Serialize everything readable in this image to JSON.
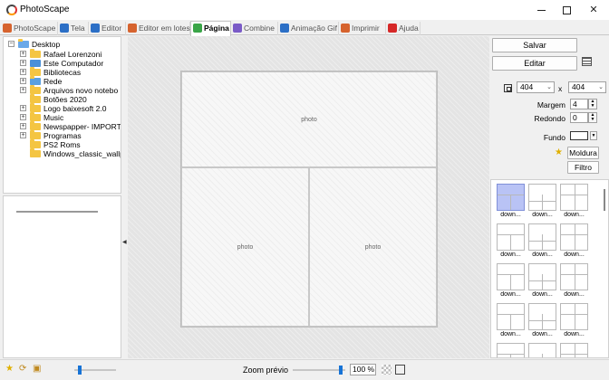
{
  "window": {
    "title": "PhotoScape",
    "min_glyph": "—",
    "close_glyph": "✕"
  },
  "tabs": [
    {
      "label": "PhotoScape",
      "icon": "photoscape-icon",
      "color": "#d6632e"
    },
    {
      "label": "Tela",
      "icon": "viewer-icon",
      "color": "#2c6fc6"
    },
    {
      "label": "Editor",
      "icon": "editor-icon",
      "color": "#2c6fc6"
    },
    {
      "label": "Editor em lotes",
      "icon": "batch-editor-icon",
      "color": "#d6632e"
    },
    {
      "label": "Página",
      "icon": "page-icon",
      "color": "#3aa548",
      "active": true
    },
    {
      "label": "Combine",
      "icon": "combine-icon",
      "color": "#7a5bc7"
    },
    {
      "label": "Animação Gif",
      "icon": "animated-gif-icon",
      "color": "#2c6fc6"
    },
    {
      "label": "Imprimir",
      "icon": "print-icon",
      "color": "#d6632e"
    },
    {
      "label": "Ajuda",
      "icon": "help-icon",
      "color": "#d62828"
    }
  ],
  "tree": {
    "root": "Desktop",
    "items": [
      {
        "label": "Rafael Lorenzoni",
        "expandable": true,
        "icon": "user-folder-icon"
      },
      {
        "label": "Este Computador",
        "expandable": true,
        "icon": "computer-icon"
      },
      {
        "label": "Bibliotecas",
        "expandable": true,
        "icon": "libraries-icon"
      },
      {
        "label": "Rede",
        "expandable": true,
        "icon": "network-icon"
      },
      {
        "label": "Arquivos novo notebo",
        "expandable": true,
        "icon": "folder-icon"
      },
      {
        "label": "Botões 2020",
        "expandable": false,
        "icon": "folder-icon"
      },
      {
        "label": "Logo baixesoft 2.0",
        "expandable": true,
        "icon": "folder-icon"
      },
      {
        "label": "Music",
        "expandable": true,
        "icon": "folder-icon"
      },
      {
        "label": "Newspapper- IMPORT",
        "expandable": true,
        "icon": "folder-icon"
      },
      {
        "label": "Programas",
        "expandable": true,
        "icon": "folder-icon"
      },
      {
        "label": "PS2 Roms",
        "expandable": false,
        "icon": "folder-icon"
      },
      {
        "label": "Windows_classic_wallp",
        "expandable": false,
        "icon": "folder-icon"
      }
    ]
  },
  "canvas": {
    "cells": [
      "photo",
      "photo",
      "photo"
    ]
  },
  "controls": {
    "save_label": "Salvar",
    "edit_label": "Editar",
    "width_value": "404",
    "height_value": "404",
    "times_sign": "x",
    "margin_label": "Margem",
    "margin_value": "4",
    "round_label": "Redondo",
    "round_value": "0",
    "background_label": "Fundo",
    "background_color": "#ffffff",
    "frame_label": "Moldura",
    "filter_label": "Filtro",
    "dropdown_arrow": "⌄"
  },
  "templates": {
    "caption": "down...",
    "rows": 5,
    "cols": 3,
    "selected_index": 0
  },
  "bottom": {
    "zoom_label": "Zoom prévio",
    "zoom_value": "100 %",
    "thumb_size_fraction": 0.1,
    "preview_zoom_fraction": 0.95
  }
}
